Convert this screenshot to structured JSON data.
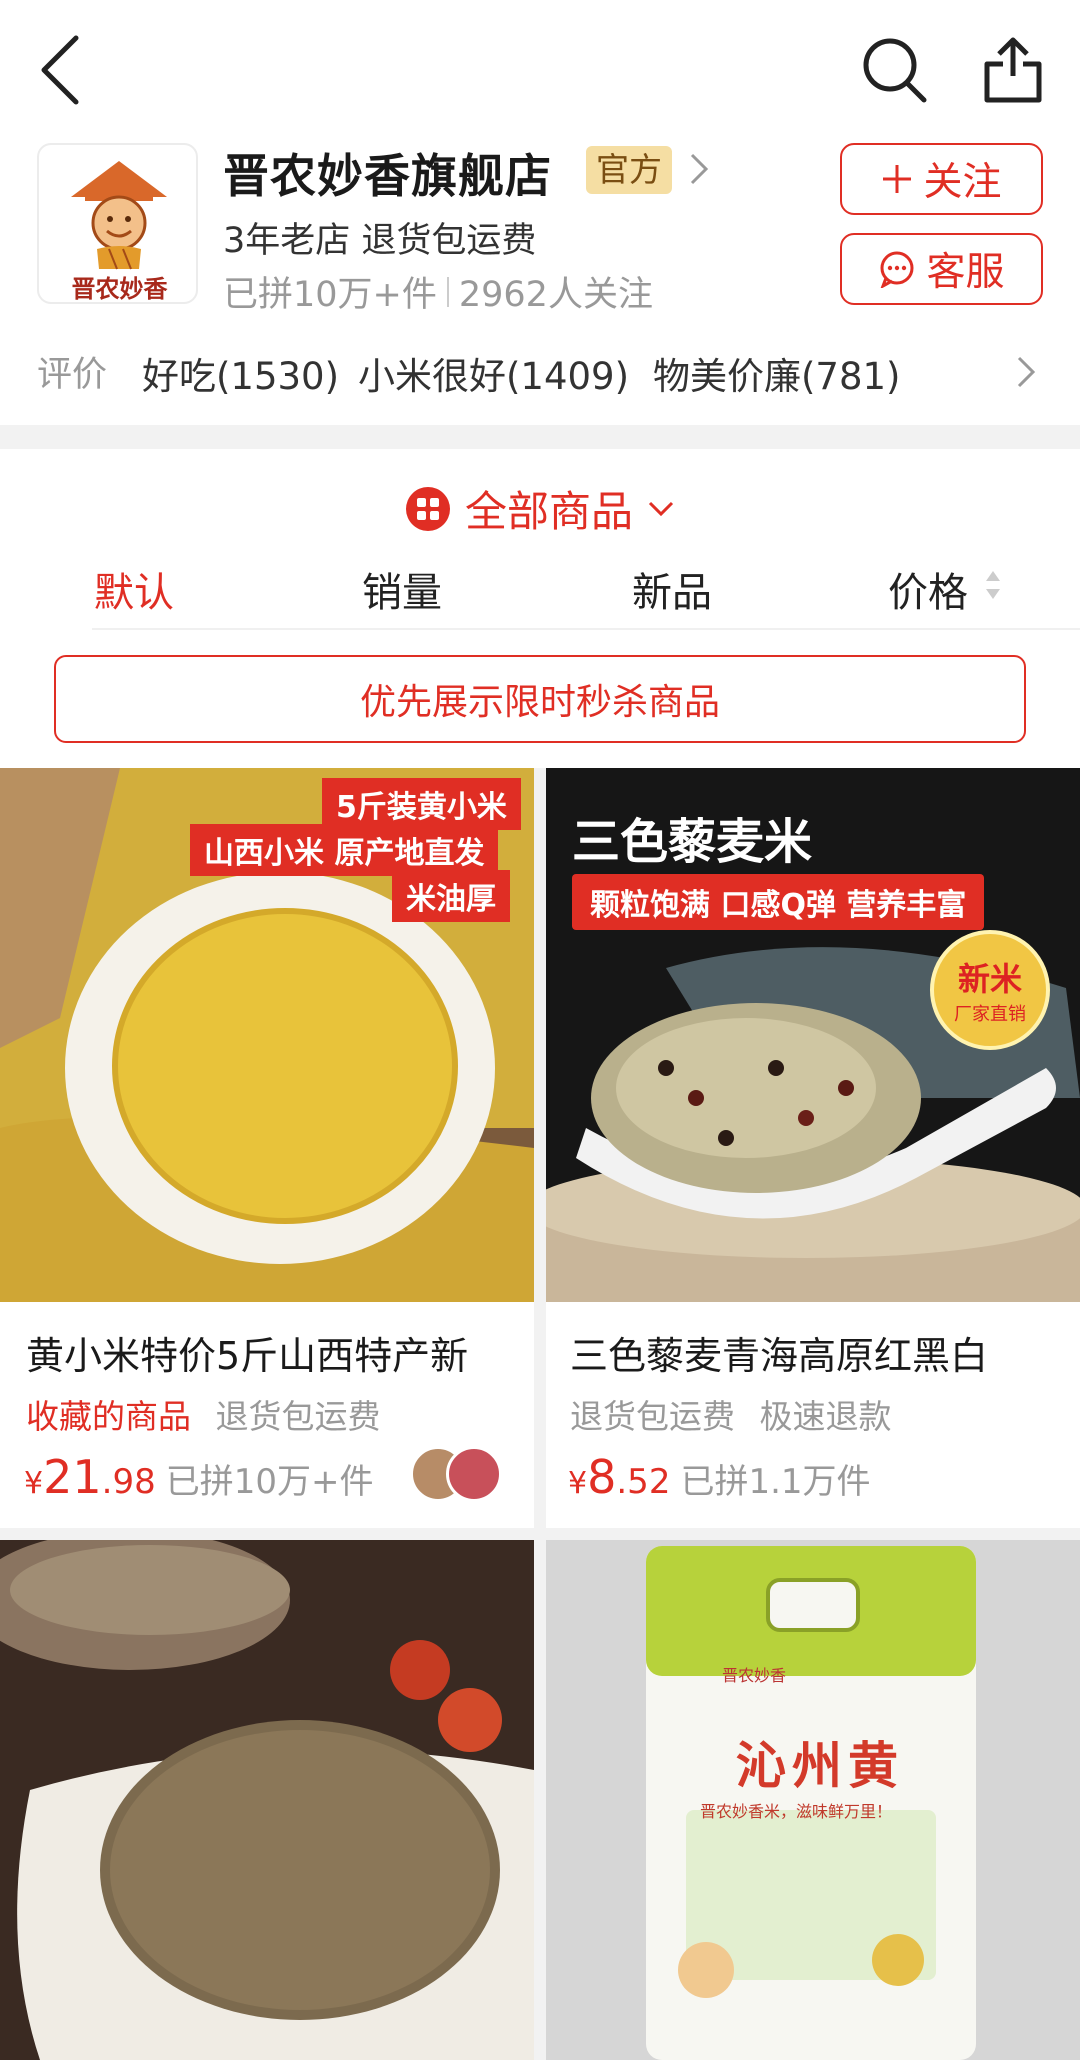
{
  "topbar": {
    "back": "back-icon",
    "search": "search-icon",
    "share": "share-icon"
  },
  "shop": {
    "logo_text": "晋农妙香",
    "name": "晋农妙香旗舰店",
    "badge": "官方",
    "line2": "3年老店 退货包运费",
    "sold": "已拼10万+件",
    "followers": "2962人关注",
    "follow_label": "关注",
    "service_label": "客服"
  },
  "reviews": {
    "label": "评价",
    "tags": [
      "好吃(1530)",
      "小米很好(1409)",
      "物美价廉(781)"
    ]
  },
  "category": {
    "label": "全部商品"
  },
  "sort_tabs": [
    "默认",
    "销量",
    "新品",
    "价格"
  ],
  "flash_sale": "优先展示限时秒杀商品",
  "products": [
    {
      "title": "黄小米特价5斤山西特产新",
      "tags": [
        {
          "text": "收藏的商品",
          "type": "red"
        },
        {
          "text": "退货包运费",
          "type": "grey"
        }
      ],
      "price_yen": "¥",
      "price_int": "21",
      "price_dec": ".98",
      "sold": "已拼10万+件",
      "banner_lines": [
        "5斤装黄小米",
        "山西小米 原产地直发",
        "米油厚"
      ]
    },
    {
      "title": "三色藜麦青海高原红黑白",
      "tags": [
        {
          "text": "退货包运费",
          "type": "grey"
        },
        {
          "text": "极速退款",
          "type": "grey"
        }
      ],
      "price_yen": "¥",
      "price_int": "8",
      "price_dec": ".52",
      "sold": "已拼1.1万件",
      "headline": "三色藜麦米",
      "subline": "颗粒饱满 口感Q弹 营养丰富",
      "seal_top": "新米",
      "seal_bottom": "厂家直销"
    }
  ],
  "bag": {
    "brand": "晋农妙香",
    "name": "沁州黄",
    "slogan": "晋农妙香米，滋味鲜万里！"
  },
  "colors": {
    "accent": "#e02e24",
    "badge_bg": "#f5dea3"
  }
}
